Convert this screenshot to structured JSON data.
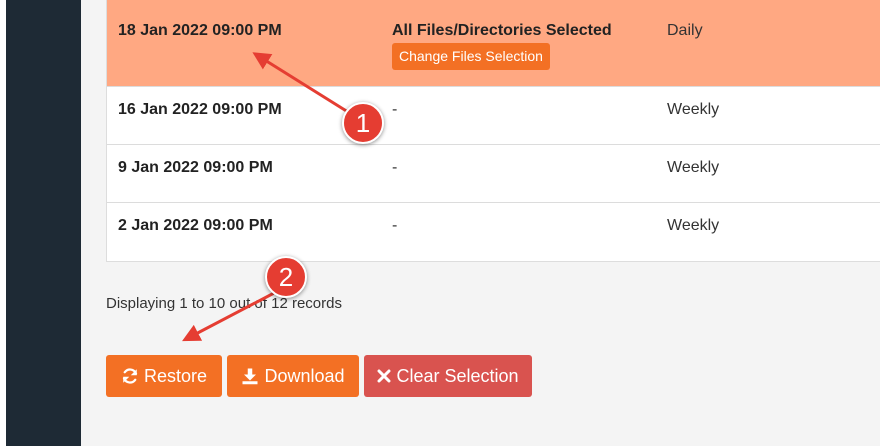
{
  "table": {
    "rows": [
      {
        "date": "18 Jan 2022 09:00 PM",
        "files": "All Files/Directories Selected",
        "frequency": "Daily",
        "action_label": "Change Files Selection"
      },
      {
        "date": "16 Jan 2022 09:00 PM",
        "files": "-",
        "frequency": "Weekly"
      },
      {
        "date": "9 Jan 2022 09:00 PM",
        "files": "-",
        "frequency": "Weekly"
      },
      {
        "date": "2 Jan 2022 09:00 PM",
        "files": "-",
        "frequency": "Weekly"
      }
    ]
  },
  "pagination": {
    "records_text": "Displaying 1 to 10 out of 12 records"
  },
  "actions": {
    "restore_label": "Restore",
    "download_label": "Download",
    "clear_label": "Clear Selection"
  },
  "annotations": {
    "badge_1": "1",
    "badge_2": "2"
  },
  "icons": {
    "restore": "refresh-icon",
    "download": "download-icon",
    "clear": "times-icon"
  },
  "colors": {
    "sidebar": "#1e2a35",
    "selected_row": "#ffa882",
    "primary_button": "#f37024",
    "danger_button": "#d9534f",
    "annotation": "#e53d32"
  }
}
